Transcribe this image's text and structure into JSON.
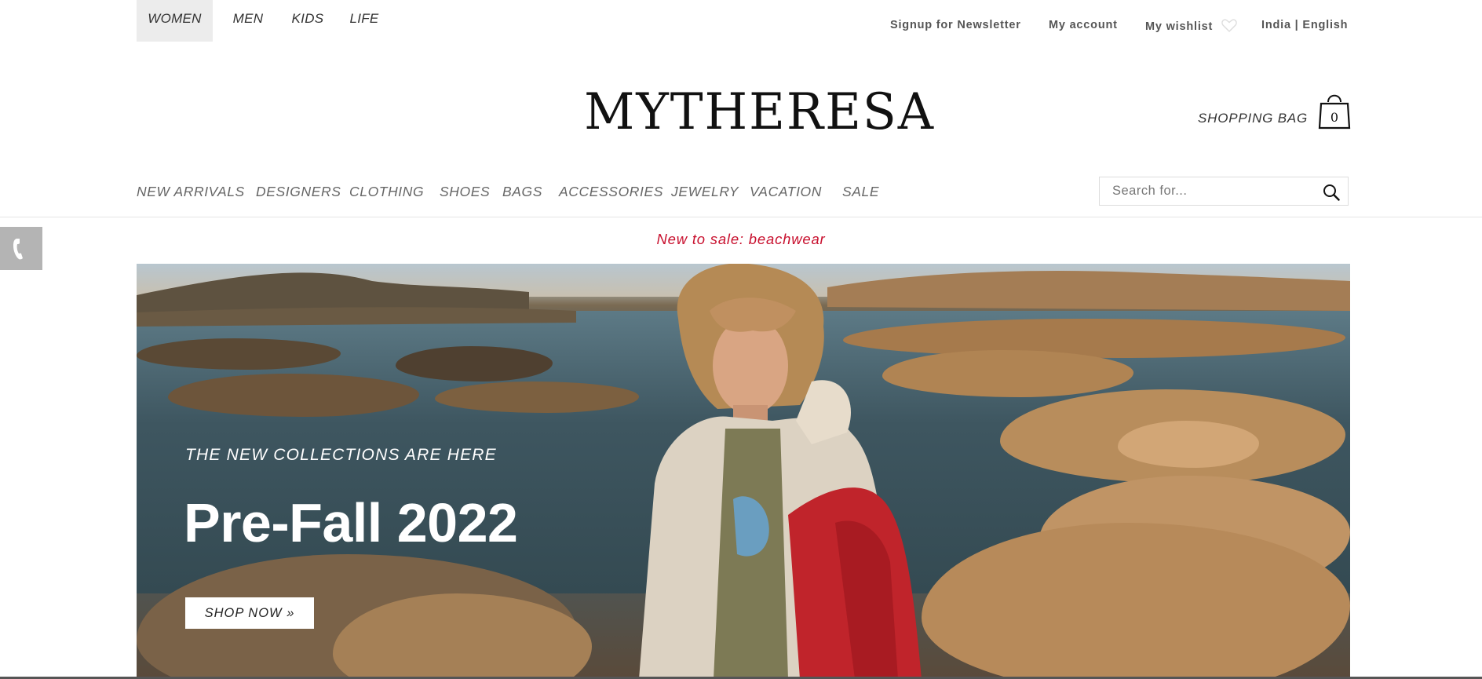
{
  "gender_tabs": [
    {
      "label": "WOMEN",
      "active": true
    },
    {
      "label": "MEN",
      "active": false
    },
    {
      "label": "KIDS",
      "active": false
    },
    {
      "label": "LIFE",
      "active": false
    }
  ],
  "utility_links": {
    "newsletter": "Signup for Newsletter",
    "account": "My account",
    "wishlist": "My wishlist",
    "locale": "India | English"
  },
  "logo_text": "MYTHERESA",
  "shopping_bag": {
    "label": "SHOPPING BAG",
    "count": "0"
  },
  "main_nav": [
    "NEW ARRIVALS",
    "DESIGNERS",
    "CLOTHING",
    "SHOES",
    "BAGS",
    "ACCESSORIES",
    "JEWELRY",
    "VACATION",
    "SALE"
  ],
  "search": {
    "placeholder": "Search for..."
  },
  "promo_banner": "New to sale: beachwear",
  "hero": {
    "kicker": "THE NEW COLLECTIONS ARE HERE",
    "title": "Pre-Fall 2022",
    "button": "SHOP NOW »"
  },
  "colors": {
    "promo": "#c8102e",
    "active_tab_bg": "#ececec",
    "phone_tab": "#b4b4b4"
  },
  "icons": [
    "heart-icon",
    "shopping-bag-icon",
    "search-icon",
    "phone-icon"
  ]
}
